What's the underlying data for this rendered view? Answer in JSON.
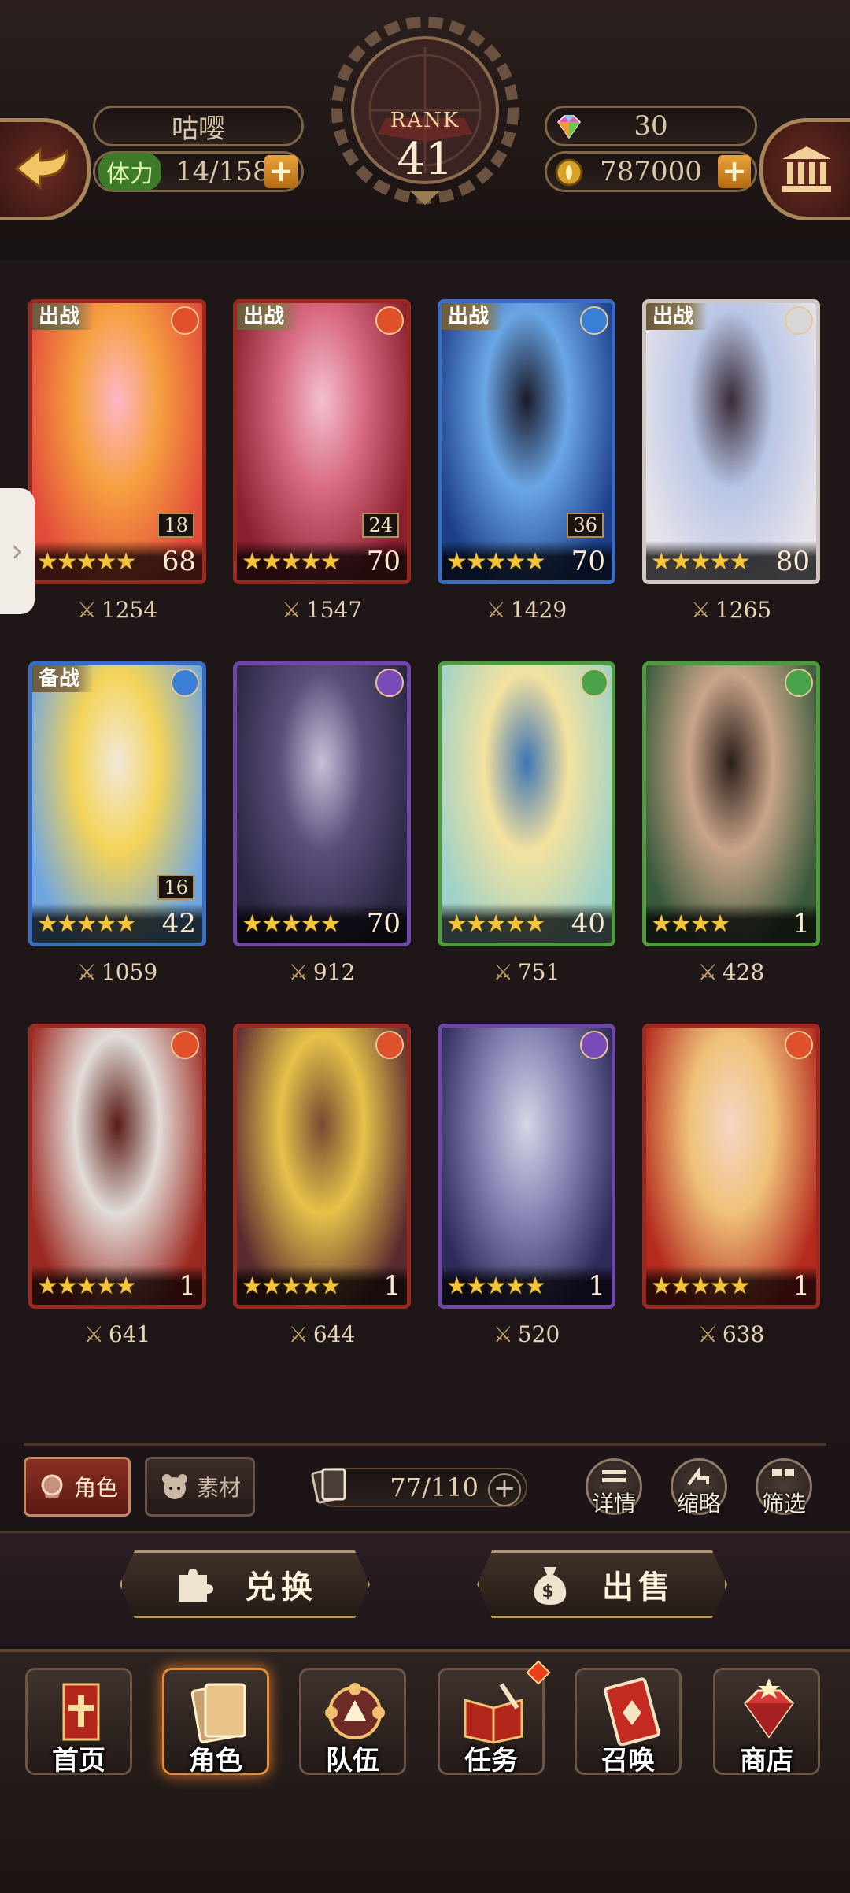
{
  "header": {
    "player_name": "咕嘤",
    "stamina_label": "体力",
    "stamina_value": "14/158",
    "rank_label": "RANK",
    "rank_value": "41",
    "gems": "30",
    "coins": "787000",
    "plus_symbol": "+"
  },
  "cards": [
    {
      "tag": "出战",
      "element": "fire",
      "badge": "18",
      "stars": "★★★★★",
      "level": "68",
      "power": "1254",
      "colors": [
        "#e24a3a",
        "#f6a040",
        "#ffb7c6"
      ]
    },
    {
      "tag": "出战",
      "element": "fire",
      "badge": "24",
      "stars": "★★★★★",
      "level": "70",
      "power": "1547",
      "colors": [
        "#8a1f2e",
        "#d86a82",
        "#f4c1cf"
      ]
    },
    {
      "tag": "出战",
      "element": "water",
      "badge": "36",
      "stars": "★★★★★",
      "level": "70",
      "power": "1429",
      "colors": [
        "#1d3f8a",
        "#6aa6e6",
        "#1a1a2a"
      ]
    },
    {
      "tag": "出战",
      "element": "light",
      "badge": "",
      "stars": "★★★★★",
      "level": "80",
      "power": "1265",
      "colors": [
        "#e6e2ea",
        "#b9c6e6",
        "#3a2a36"
      ]
    },
    {
      "tag": "备战",
      "element": "water",
      "badge": "16",
      "stars": "★★★★★",
      "level": "42",
      "power": "1059",
      "colors": [
        "#6fa6e0",
        "#f4d45a",
        "#f2e8d8"
      ]
    },
    {
      "tag": "",
      "element": "dark",
      "badge": "",
      "stars": "★★★★★",
      "level": "70",
      "power": "912",
      "colors": [
        "#2a2540",
        "#5a4e7a",
        "#c8c0d8"
      ]
    },
    {
      "tag": "",
      "element": "wood",
      "badge": "",
      "stars": "★★★★★",
      "level": "40",
      "power": "751",
      "colors": [
        "#9fd2c8",
        "#f3e2a0",
        "#3e74b4"
      ]
    },
    {
      "tag": "",
      "element": "wood",
      "badge": "",
      "stars": "★★★★",
      "level": "1",
      "power": "428",
      "colors": [
        "#3a5a3c",
        "#c9a48a",
        "#2a1e1a"
      ]
    },
    {
      "tag": "",
      "element": "fire",
      "badge": "",
      "stars": "★★★★★",
      "level": "1",
      "power": "641",
      "colors": [
        "#9c2a22",
        "#e2dcd8",
        "#5a1a14"
      ]
    },
    {
      "tag": "",
      "element": "fire",
      "badge": "",
      "stars": "★★★★★",
      "level": "1",
      "power": "644",
      "colors": [
        "#5a2a30",
        "#e6c24a",
        "#7a4a32"
      ]
    },
    {
      "tag": "",
      "element": "dark",
      "badge": "",
      "stars": "★★★★★",
      "level": "1",
      "power": "520",
      "colors": [
        "#2e2a5a",
        "#8a8ab8",
        "#d6d6e6"
      ]
    },
    {
      "tag": "",
      "element": "fire",
      "badge": "",
      "stars": "★★★★★",
      "level": "1",
      "power": "638",
      "colors": [
        "#b52a1e",
        "#f0c27a",
        "#f6d6c6"
      ]
    }
  ],
  "filters": {
    "characters": "角色",
    "materials": "素材",
    "capacity": "77/110",
    "details": "详情",
    "summary": "缩略",
    "filter": "筛选"
  },
  "actions": {
    "exchange": "兑换",
    "sell": "出售"
  },
  "nav": [
    {
      "label": "首页",
      "icon": "home-banner-icon"
    },
    {
      "label": "角色",
      "icon": "character-card-icon"
    },
    {
      "label": "队伍",
      "icon": "team-icon"
    },
    {
      "label": "任务",
      "icon": "quest-book-icon"
    },
    {
      "label": "召唤",
      "icon": "summon-card-icon"
    },
    {
      "label": "商店",
      "icon": "shop-gem-icon"
    }
  ],
  "element_colors": {
    "fire": "#e0502a",
    "water": "#3a7fd6",
    "light": "#d8d8d8",
    "dark": "#7a4ab8",
    "wood": "#4aa24a"
  }
}
